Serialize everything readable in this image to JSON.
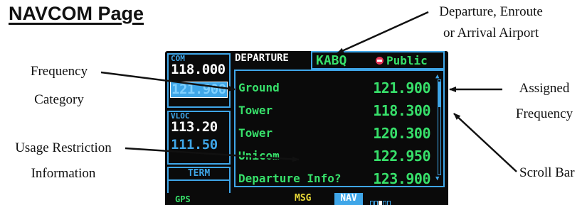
{
  "page": {
    "title": "NAVCOM Page"
  },
  "callouts": {
    "departure_airport_line1": "Departure, Enroute",
    "departure_airport_line2": "or Arrival Airport",
    "frequency_category_line1": "Frequency",
    "frequency_category_line2": "Category",
    "assigned_frequency_line1": "Assigned",
    "assigned_frequency_line2": "Frequency",
    "usage_restriction_line1": "Usage Restriction",
    "usage_restriction_line2": "Information",
    "scroll_bar": "Scroll Bar"
  },
  "com": {
    "label": "COM",
    "active": "118.000",
    "standby": "121.900"
  },
  "vloc": {
    "label": "VLOC",
    "active": "113.20",
    "standby": "111.50"
  },
  "term": {
    "label": "TERM"
  },
  "navcom": {
    "mode_label": "DEPARTURE",
    "airport_ident": "KABQ",
    "usage": "Public",
    "frequencies": [
      {
        "name": "Ground",
        "freq": "121.900"
      },
      {
        "name": "Tower",
        "freq": "118.300"
      },
      {
        "name": "Tower",
        "freq": "120.300"
      },
      {
        "name": "Unicom",
        "freq": "122.950"
      },
      {
        "name": "Departure Info?",
        "freq": "123.900"
      }
    ]
  },
  "statusbar": {
    "gps": "GPS",
    "msg": "MSG",
    "nav": "NAV",
    "page_group_count": 5,
    "current_page_index": 2
  },
  "colors": {
    "screen_bg": "#0a0a0a",
    "frame_blue": "#3fa6e8",
    "text_green": "#37e06a",
    "msg_yellow": "#e8d837",
    "public_marker": "#e8375a"
  }
}
